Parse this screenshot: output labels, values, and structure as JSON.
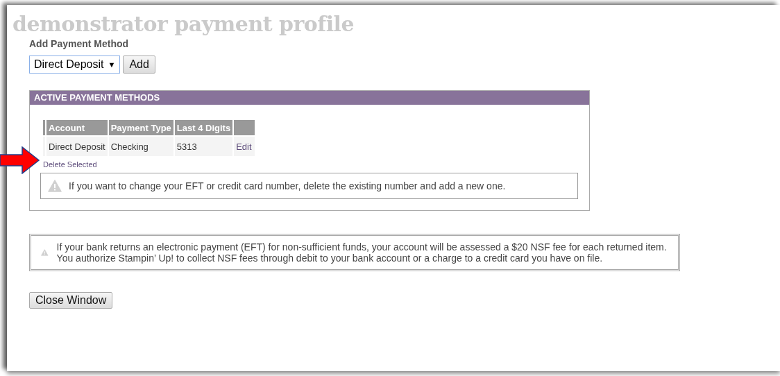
{
  "page_title": "demonstrator payment profile",
  "add_method": {
    "label": "Add Payment Method",
    "select_value": "Direct Deposit",
    "select_caret": "▼",
    "button": "Add"
  },
  "active_panel": {
    "title": "ACTIVE PAYMENT METHODS",
    "columns": [
      "Account",
      "Payment Type",
      "Last 4 Digits"
    ],
    "rows": [
      {
        "cells": [
          "Direct Deposit",
          "Checking",
          "5313"
        ],
        "action": "Edit"
      }
    ],
    "delete_link": "Delete Selected",
    "notice": "If you want to change your EFT or credit card number, delete the existing number and add a new one."
  },
  "nsf_notice": "If your bank returns an electronic payment (EFT) for non-sufficient funds, your account will be assessed a $20 NSF fee for each returned item.  You authorize Stampin’ Up! to collect NSF fees through debit to your bank account or a charge to a credit card you have on file.",
  "close_button": "Close Window"
}
